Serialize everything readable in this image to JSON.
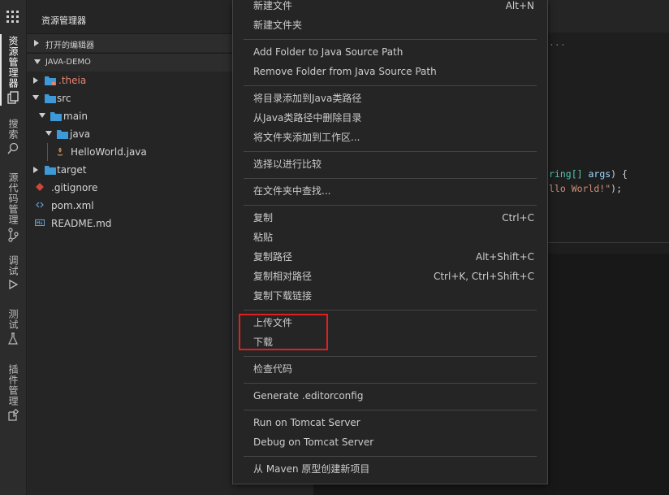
{
  "activity_bar": {
    "tabs": [
      {
        "label": "资源管理器",
        "icon": "files-icon",
        "active": true
      },
      {
        "label": "搜索",
        "icon": "search-icon"
      },
      {
        "label": "源代码管理",
        "icon": "source-control-icon"
      },
      {
        "label": "调试",
        "icon": "debug-icon"
      },
      {
        "label": "测试",
        "icon": "flask-icon"
      },
      {
        "label": "插件管理",
        "icon": "extensions-icon"
      }
    ]
  },
  "sidebar": {
    "title": "资源管理器",
    "open_editors": "打开的编辑器",
    "project": "JAVA-DEMO",
    "tree": [
      {
        "label": ".theia",
        "icon": "folder-icon",
        "color": "#e8846e"
      },
      {
        "label": "src",
        "icon": "folder-icon"
      },
      {
        "label": "main",
        "icon": "folder-icon"
      },
      {
        "label": "java",
        "icon": "folder-icon"
      },
      {
        "label": "HelloWorld.java",
        "icon": "java-file-icon"
      },
      {
        "label": "target",
        "icon": "folder-icon"
      },
      {
        "label": ".gitignore",
        "icon": "git-icon"
      },
      {
        "label": "pom.xml",
        "icon": "xml-icon"
      },
      {
        "label": "README.md",
        "icon": "markdown-icon"
      }
    ]
  },
  "editor": {
    "ellipsis": "...",
    "line1_a": "ring[] ",
    "line1_b": "args",
    "line1_c": ") {",
    "line2_a": "llo World!\"",
    "line2_b": ");"
  },
  "context_menu": {
    "new_file": {
      "label": "新建文件",
      "shortcut": "Alt+N"
    },
    "new_folder": "新建文件夹",
    "add_java_source": "Add Folder to Java Source Path",
    "remove_java_source": "Remove Folder from Java Source Path",
    "add_dir_java_path": "将目录添加到Java类路径",
    "remove_dir_java_path": "从Java类路径中删除目录",
    "add_to_workspace": "将文件夹添加到工作区...",
    "select_compare": "选择以进行比较",
    "find_in_folder": "在文件夹中查找...",
    "copy": {
      "label": "复制",
      "shortcut": "Ctrl+C"
    },
    "paste": "粘贴",
    "copy_path": {
      "label": "复制路径",
      "shortcut": "Alt+Shift+C"
    },
    "copy_relative_path": {
      "label": "复制相对路径",
      "shortcut": "Ctrl+K, Ctrl+Shift+C"
    },
    "copy_download_link": "复制下载链接",
    "upload_files": "上传文件",
    "download": "下载",
    "check_code": "检查代码",
    "generate_editorconfig": "Generate .editorconfig",
    "run_tomcat": "Run on Tomcat Server",
    "debug_tomcat": "Debug on Tomcat Server",
    "maven_archetype": "从 Maven 原型创建新项目"
  },
  "colors": {
    "highlight_box": "#e0201f",
    "folder": "#3d9ad6",
    "accent": "#ffffff"
  }
}
